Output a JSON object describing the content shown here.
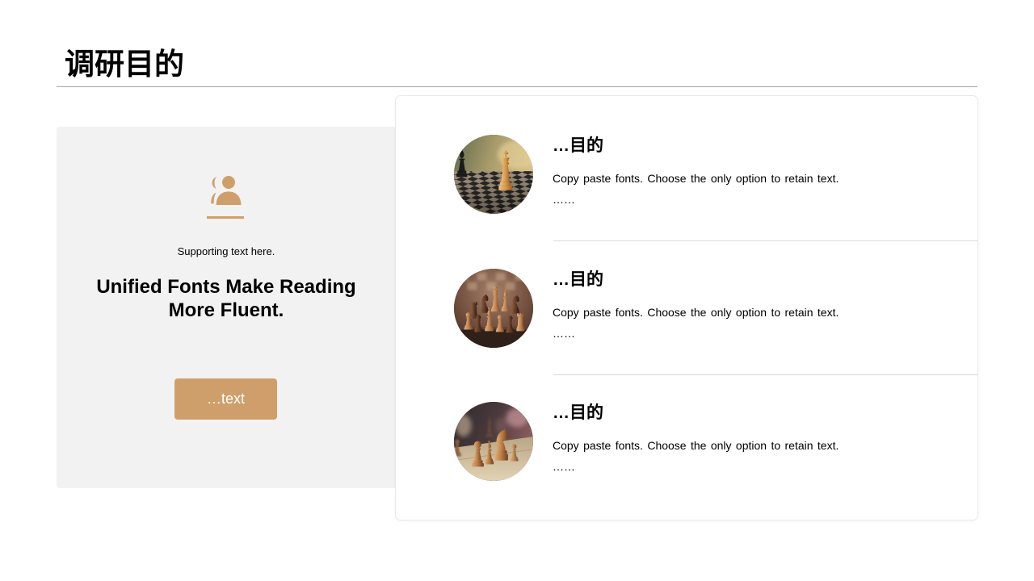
{
  "slide": {
    "title": "调研目的"
  },
  "left_panel": {
    "icon": "user-group-icon",
    "supporting_text": "Supporting text here.",
    "headline": "Unified Fonts Make Reading More Fluent.",
    "button_label": "…text"
  },
  "items": [
    {
      "image": "chess-photo",
      "heading": "…目的",
      "description": "Copy paste fonts. Choose the only option to retain text.",
      "more": "……"
    },
    {
      "image": "chess-photo",
      "heading": "…目的",
      "description": "Copy paste fonts. Choose the only option to retain text.",
      "more": "……"
    },
    {
      "image": "chess-photo",
      "heading": "…目的",
      "description": "Copy paste fonts. Choose the only option to retain text.",
      "more": "……"
    }
  ],
  "colors": {
    "accent": "#cf9f6b",
    "panel_background": "#f2f2f2",
    "title_rule": "#a6a6a6",
    "divider": "#d9d9d9",
    "text": "#000000"
  }
}
